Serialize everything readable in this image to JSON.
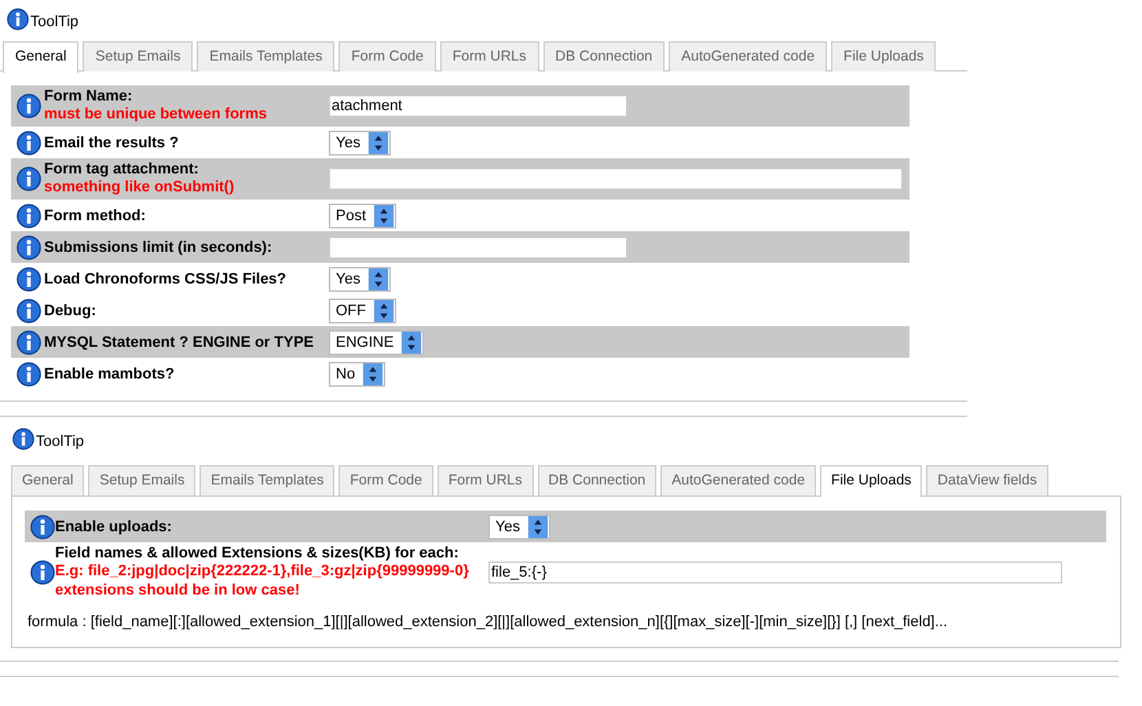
{
  "panels": [
    {
      "header": {
        "label": "ToolTip"
      },
      "tabs": [
        {
          "label": "General",
          "selected": true
        },
        {
          "label": "Setup Emails",
          "selected": false
        },
        {
          "label": "Emails Templates",
          "selected": false
        },
        {
          "label": "Form Code",
          "selected": false
        },
        {
          "label": "Form URLs",
          "selected": false
        },
        {
          "label": "DB Connection",
          "selected": false
        },
        {
          "label": "AutoGenerated code",
          "selected": false
        },
        {
          "label": "File Uploads",
          "selected": false
        }
      ],
      "rows": [
        {
          "label": "Form Name:",
          "notes": [
            "must be unique between forms"
          ],
          "shaded": true,
          "kind": "input",
          "wide": false,
          "value": "atachment"
        },
        {
          "label": "Email the results ?",
          "shaded": false,
          "kind": "select",
          "value": "Yes"
        },
        {
          "label": "Form tag attachment:",
          "notes": [
            "something like onSubmit()"
          ],
          "shaded": true,
          "kind": "input",
          "wide": true
        },
        {
          "label": "Form method:",
          "shaded": false,
          "kind": "select",
          "value": "Post"
        },
        {
          "label": "Submissions limit (in seconds):",
          "shaded": true,
          "kind": "input",
          "wide": false
        },
        {
          "label": "Load Chronoforms CSS/JS Files?",
          "shaded": false,
          "kind": "select",
          "value": "Yes"
        },
        {
          "label": "Debug:",
          "shaded": false,
          "kind": "select",
          "value": "OFF"
        },
        {
          "label": "MYSQL Statement ? ENGINE or TYPE",
          "shaded": true,
          "kind": "select",
          "value": "ENGINE"
        },
        {
          "label": "Enable mambots?",
          "shaded": false,
          "kind": "select",
          "value": "No"
        }
      ]
    },
    {
      "header": {
        "label": "ToolTip"
      },
      "tabs": [
        {
          "label": "General",
          "selected": false
        },
        {
          "label": "Setup Emails",
          "selected": false
        },
        {
          "label": "Emails Templates",
          "selected": false
        },
        {
          "label": "Form Code",
          "selected": false
        },
        {
          "label": "Form URLs",
          "selected": false
        },
        {
          "label": "DB Connection",
          "selected": false
        },
        {
          "label": "AutoGenerated code",
          "selected": false
        },
        {
          "label": "File Uploads",
          "selected": true
        },
        {
          "label": "DataView fields",
          "selected": false
        }
      ],
      "rows": [
        {
          "label": "Enable uploads:",
          "shaded": true,
          "kind": "select",
          "value": "Yes"
        },
        {
          "label": "Field names & allowed Extensions & sizes(KB) for each:",
          "notes": [
            "E.g: file_2:jpg|doc|zip{222222-1},file_3:gz|zip{99999999-0}",
            "extensions should be in low case!"
          ],
          "shaded": false,
          "kind": "input",
          "wide": true,
          "value": "file_5:{-}"
        }
      ],
      "formula": "formula : [field_name][:][allowed_extension_1][|][allowed_extension_2][|][allowed_extension_n][{][max_size][-][min_size][}] [,] [next_field]..."
    }
  ]
}
